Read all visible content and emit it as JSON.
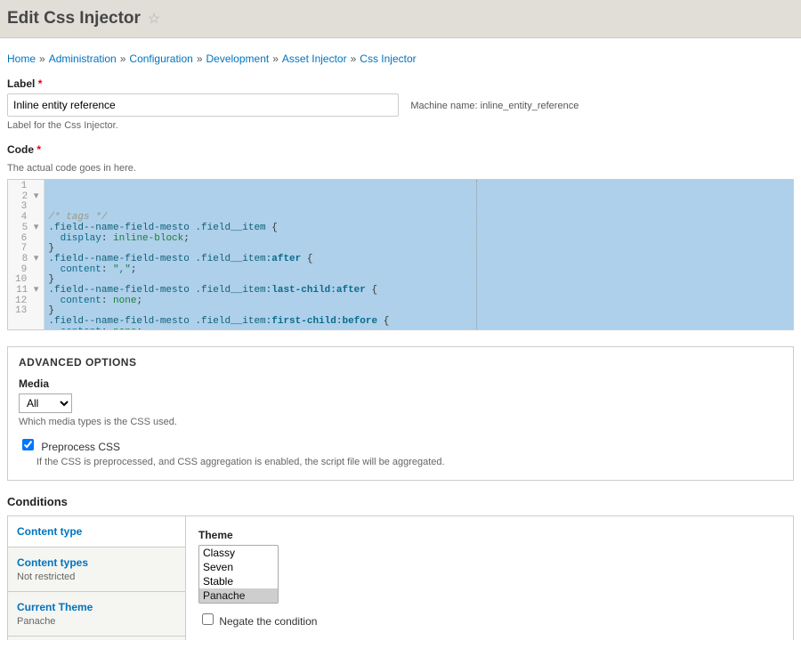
{
  "header": {
    "title": "Edit Css Injector"
  },
  "breadcrumb": [
    {
      "label": "Home"
    },
    {
      "label": "Administration"
    },
    {
      "label": "Configuration"
    },
    {
      "label": "Development"
    },
    {
      "label": "Asset Injector"
    },
    {
      "label": "Css Injector"
    }
  ],
  "form": {
    "label_field": {
      "label": "Label",
      "value": "Inline entity reference",
      "description": "Label for the Css Injector.",
      "machine_name_label": "Machine name:",
      "machine_name_value": "inline_entity_reference"
    },
    "code_field": {
      "label": "Code",
      "description": "The actual code goes in here.",
      "lines": [
        {
          "n": "1",
          "fold": " ",
          "html": "<span class='c-comment'>/* tags */</span>"
        },
        {
          "n": "2",
          "fold": "▾",
          "html": "<span class='c-sel'>.field--name-field-mesto .field__item</span> <span class='c-punc'>{</span>"
        },
        {
          "n": "3",
          "fold": " ",
          "html": "  <span class='c-prop'>display</span><span class='c-punc'>:</span> <span class='c-val'>inline-block</span><span class='c-punc'>;</span>"
        },
        {
          "n": "4",
          "fold": " ",
          "html": "<span class='c-punc'>}</span>"
        },
        {
          "n": "5",
          "fold": "▾",
          "html": "<span class='c-sel'>.field--name-field-mesto .field__item</span><span class='c-pseudo'>:after</span> <span class='c-punc'>{</span>"
        },
        {
          "n": "6",
          "fold": " ",
          "html": "  <span class='c-prop'>content</span><span class='c-punc'>:</span> <span class='c-val'>\",\"</span><span class='c-punc'>;</span>"
        },
        {
          "n": "7",
          "fold": " ",
          "html": "<span class='c-punc'>}</span>"
        },
        {
          "n": "8",
          "fold": "▾",
          "html": "<span class='c-sel'>.field--name-field-mesto .field__item</span><span class='c-pseudo'>:last-child:after</span> <span class='c-punc'>{</span>"
        },
        {
          "n": "9",
          "fold": " ",
          "html": "  <span class='c-prop'>content</span><span class='c-punc'>:</span> <span class='c-val'>none</span><span class='c-punc'>;</span>"
        },
        {
          "n": "10",
          "fold": " ",
          "html": "<span class='c-punc'>}</span>"
        },
        {
          "n": "11",
          "fold": "▾",
          "html": "<span class='c-sel'>.field--name-field-mesto .field__item</span><span class='c-pseudo'>:first-child:before</span> <span class='c-punc'>{</span>"
        },
        {
          "n": "12",
          "fold": " ",
          "html": "  <span class='c-prop'>content</span><span class='c-punc'>:</span> <span class='c-val'>none</span><span class='c-punc'>;</span>"
        },
        {
          "n": "13",
          "fold": " ",
          "html": "<span class='c-punc'>}</span>"
        }
      ]
    }
  },
  "advanced": {
    "legend": "ADVANCED OPTIONS",
    "media_label": "Media",
    "media_value": "All",
    "media_description": "Which media types is the CSS used.",
    "preprocess_label": "Preprocess CSS",
    "preprocess_checked": true,
    "preprocess_description": "If the CSS is preprocessed, and CSS aggregation is enabled, the script file will be aggregated."
  },
  "conditions": {
    "heading": "Conditions",
    "tabs": [
      {
        "title": "Content type",
        "summary": ""
      },
      {
        "title": "Content types",
        "summary": "Not restricted"
      },
      {
        "title": "Current Theme",
        "summary": "Panache"
      }
    ],
    "pane": {
      "theme_label": "Theme",
      "theme_options": [
        "Classy",
        "Seven",
        "Stable",
        "Panache"
      ],
      "theme_selected": "Panache",
      "negate_label": "Negate the condition",
      "negate_checked": false
    }
  }
}
